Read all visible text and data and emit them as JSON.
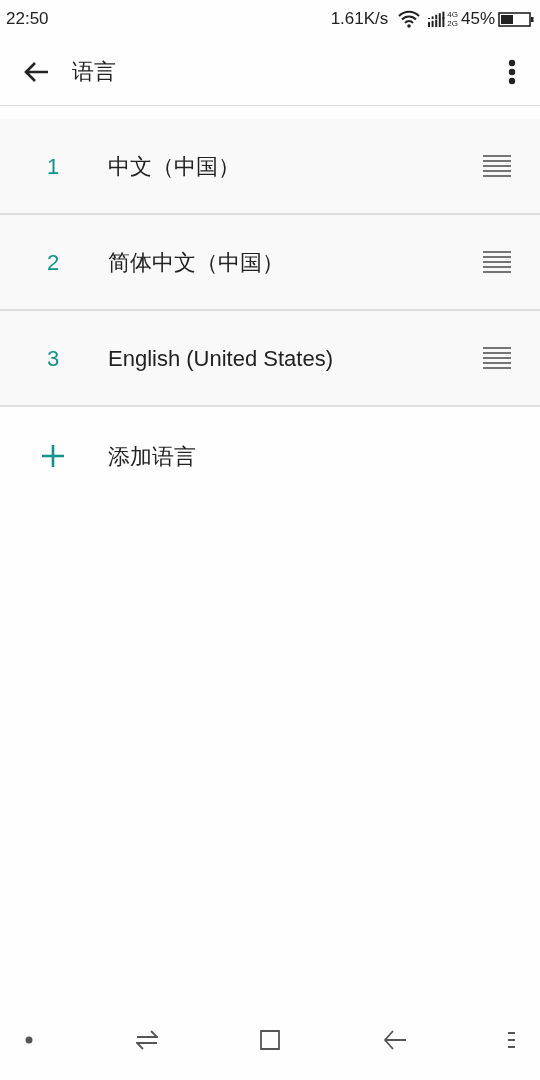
{
  "status_bar": {
    "time": "22:50",
    "speed": "1.61K/s",
    "network_top": "4G",
    "network_bottom": "2G",
    "battery": "45%"
  },
  "toolbar": {
    "title": "语言"
  },
  "languages": [
    {
      "number": "1",
      "name": "中文（中国）"
    },
    {
      "number": "2",
      "name": "简体中文（中国）"
    },
    {
      "number": "3",
      "name": "English (United States)"
    }
  ],
  "add_language": {
    "label": "添加语言"
  }
}
